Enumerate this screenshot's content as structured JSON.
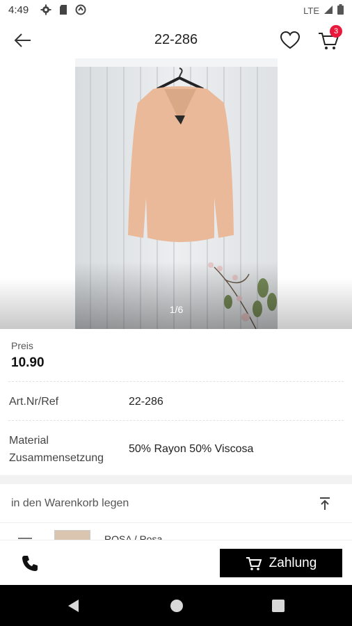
{
  "status_bar": {
    "time": "4:49",
    "network": "LTE",
    "icons": [
      "gear-icon",
      "sd-card-icon",
      "sync-icon",
      "signal-icon",
      "battery-icon"
    ]
  },
  "app_bar": {
    "title": "22-286",
    "cart_count": "3",
    "icons": [
      "back-arrow-icon",
      "heart-icon",
      "cart-icon"
    ]
  },
  "gallery": {
    "counter": "1/6"
  },
  "product": {
    "price_label": "Preis",
    "price_value": "10.90",
    "details": [
      {
        "label": "Art.Nr/Ref",
        "value": "22-286"
      },
      {
        "label": "Material\nZusammensetzung",
        "value": "50% Rayon 50% Viscosa"
      }
    ]
  },
  "cart_section": {
    "label": "in den Warenkorb legen",
    "variant_name": "ROSA / Rosa"
  },
  "bottom_bar": {
    "pay_label": "Zahlung",
    "icons": [
      "phone-icon",
      "cart-icon"
    ]
  },
  "colors": {
    "accent_badge": "#e8193c",
    "pay_button_bg": "#000000",
    "blouse": "#e9b99a"
  }
}
